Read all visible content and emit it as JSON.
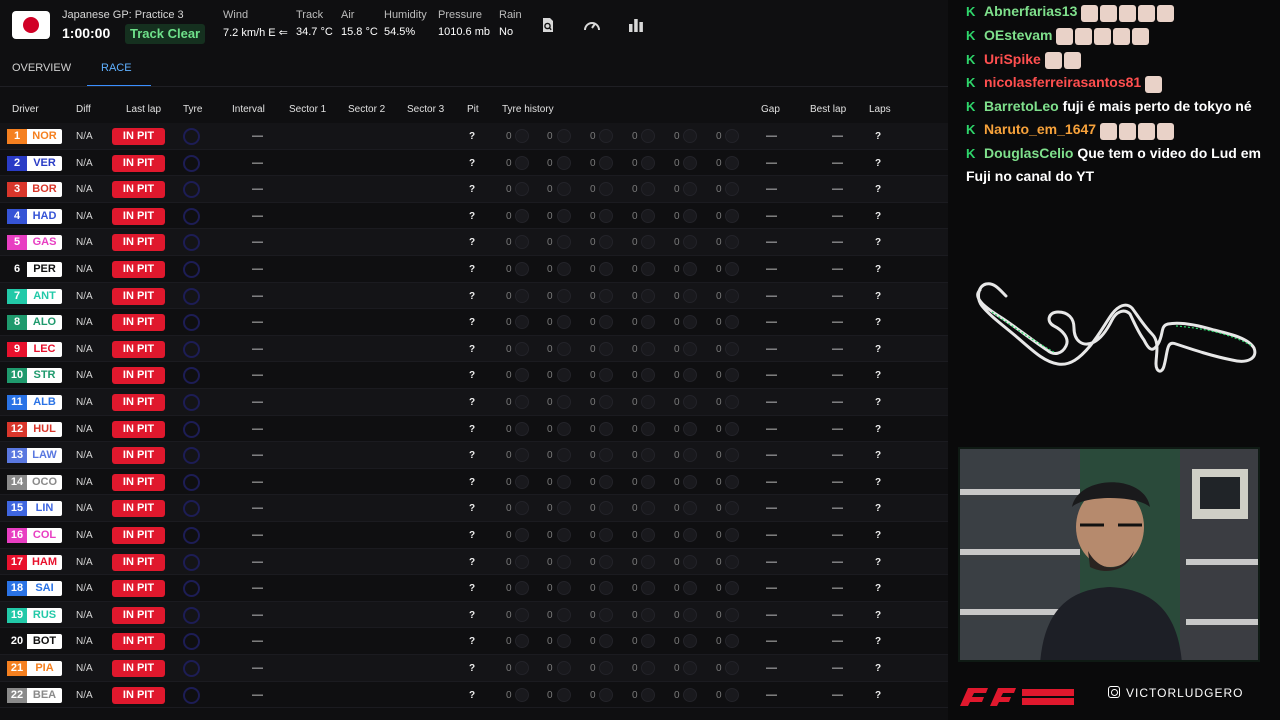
{
  "session": {
    "name": "Japanese GP: Practice 3",
    "clock": "1:00:00",
    "track_status": "Track Clear",
    "weather": [
      {
        "label": "Wind",
        "value": "7.2 km/h E ⇐"
      },
      {
        "label": "Track",
        "value": "34.7 °C"
      },
      {
        "label": "Air",
        "value": "15.8 °C"
      },
      {
        "label": "Humidity",
        "value": "54.5%"
      },
      {
        "label": "Pressure",
        "value": "1010.6 mb"
      },
      {
        "label": "Rain",
        "value": "No"
      }
    ],
    "tool_icons": [
      "search-page-icon",
      "speedometer-icon",
      "bar-chart-icon"
    ]
  },
  "tabs": [
    {
      "label": "OVERVIEW",
      "active": false
    },
    {
      "label": "RACE",
      "active": true
    }
  ],
  "columns": [
    "Driver",
    "Diff",
    "Last lap",
    "Tyre",
    "Interval",
    "Sector 1",
    "Sector 2",
    "Sector 3",
    "Pit",
    "Tyre history",
    "Gap",
    "Best lap",
    "Laps"
  ],
  "drivers": [
    {
      "pos": "1",
      "code": "NOR",
      "color": "#f58020"
    },
    {
      "pos": "2",
      "code": "VER",
      "color": "#2a3cc6"
    },
    {
      "pos": "3",
      "code": "BOR",
      "color": "#d9362b"
    },
    {
      "pos": "4",
      "code": "HAD",
      "color": "#3654d6"
    },
    {
      "pos": "5",
      "code": "GAS",
      "color": "#e83ec2"
    },
    {
      "pos": "6",
      "code": "PER",
      "color": ""
    },
    {
      "pos": "7",
      "code": "ANT",
      "color": "#22c9a8"
    },
    {
      "pos": "8",
      "code": "ALO",
      "color": "#1f9a6d"
    },
    {
      "pos": "9",
      "code": "LEC",
      "color": "#e8112d"
    },
    {
      "pos": "10",
      "code": "STR",
      "color": "#1f9a6d"
    },
    {
      "pos": "11",
      "code": "ALB",
      "color": "#2a73e6"
    },
    {
      "pos": "12",
      "code": "HUL",
      "color": "#d9362b"
    },
    {
      "pos": "13",
      "code": "LAW",
      "color": "#5a78e0"
    },
    {
      "pos": "14",
      "code": "OCO",
      "color": "#8a8a8a"
    },
    {
      "pos": "15",
      "code": "LIN",
      "color": "#3f66e0"
    },
    {
      "pos": "16",
      "code": "COL",
      "color": "#e83ec2"
    },
    {
      "pos": "17",
      "code": "HAM",
      "color": "#e8112d"
    },
    {
      "pos": "18",
      "code": "SAI",
      "color": "#2a73e6"
    },
    {
      "pos": "19",
      "code": "RUS",
      "color": "#22c9a8"
    },
    {
      "pos": "20",
      "code": "BOT",
      "color": ""
    },
    {
      "pos": "21",
      "code": "PIA",
      "color": "#f58020"
    },
    {
      "pos": "22",
      "code": "BEA",
      "color": "#8a8a8a"
    }
  ],
  "row_values": {
    "diff": "N/A",
    "status": "IN PIT",
    "interval": "—",
    "pit": "?",
    "tyre_history": [
      "0",
      "0",
      "0",
      "0",
      "0",
      "0"
    ],
    "gap": "—",
    "best_lap": "—",
    "laps": "?"
  },
  "chat": [
    {
      "user": "Abnerfarias13",
      "user_color": "#7fe08c",
      "text": "",
      "emotes": 5
    },
    {
      "user": "OEstevam",
      "user_color": "#7fe08c",
      "text": "",
      "emotes": 5
    },
    {
      "user": "UriSpike",
      "user_color": "#ff4f4f",
      "text": "",
      "emotes": 2
    },
    {
      "user": "nicolasferreirasantos81",
      "user_color": "#ff4f4f",
      "text": "",
      "emotes": 1
    },
    {
      "user": "BarretoLeo",
      "user_color": "#7fe08c",
      "text": "fuji é mais perto de tokyo né",
      "emotes": 0
    },
    {
      "user": "Naruto_em_1647",
      "user_color": "#f7a23b",
      "text": "",
      "emotes": 4
    },
    {
      "user": "DouglasCelio",
      "user_color": "#7fe08c",
      "text": "Que tem o video do Lud em Fuji no canal do YT",
      "emotes": 0
    }
  ],
  "chat_badge": "K",
  "branding": {
    "logo": "F1 Live Timing",
    "social_handle": "VICTORLUDGERO"
  }
}
